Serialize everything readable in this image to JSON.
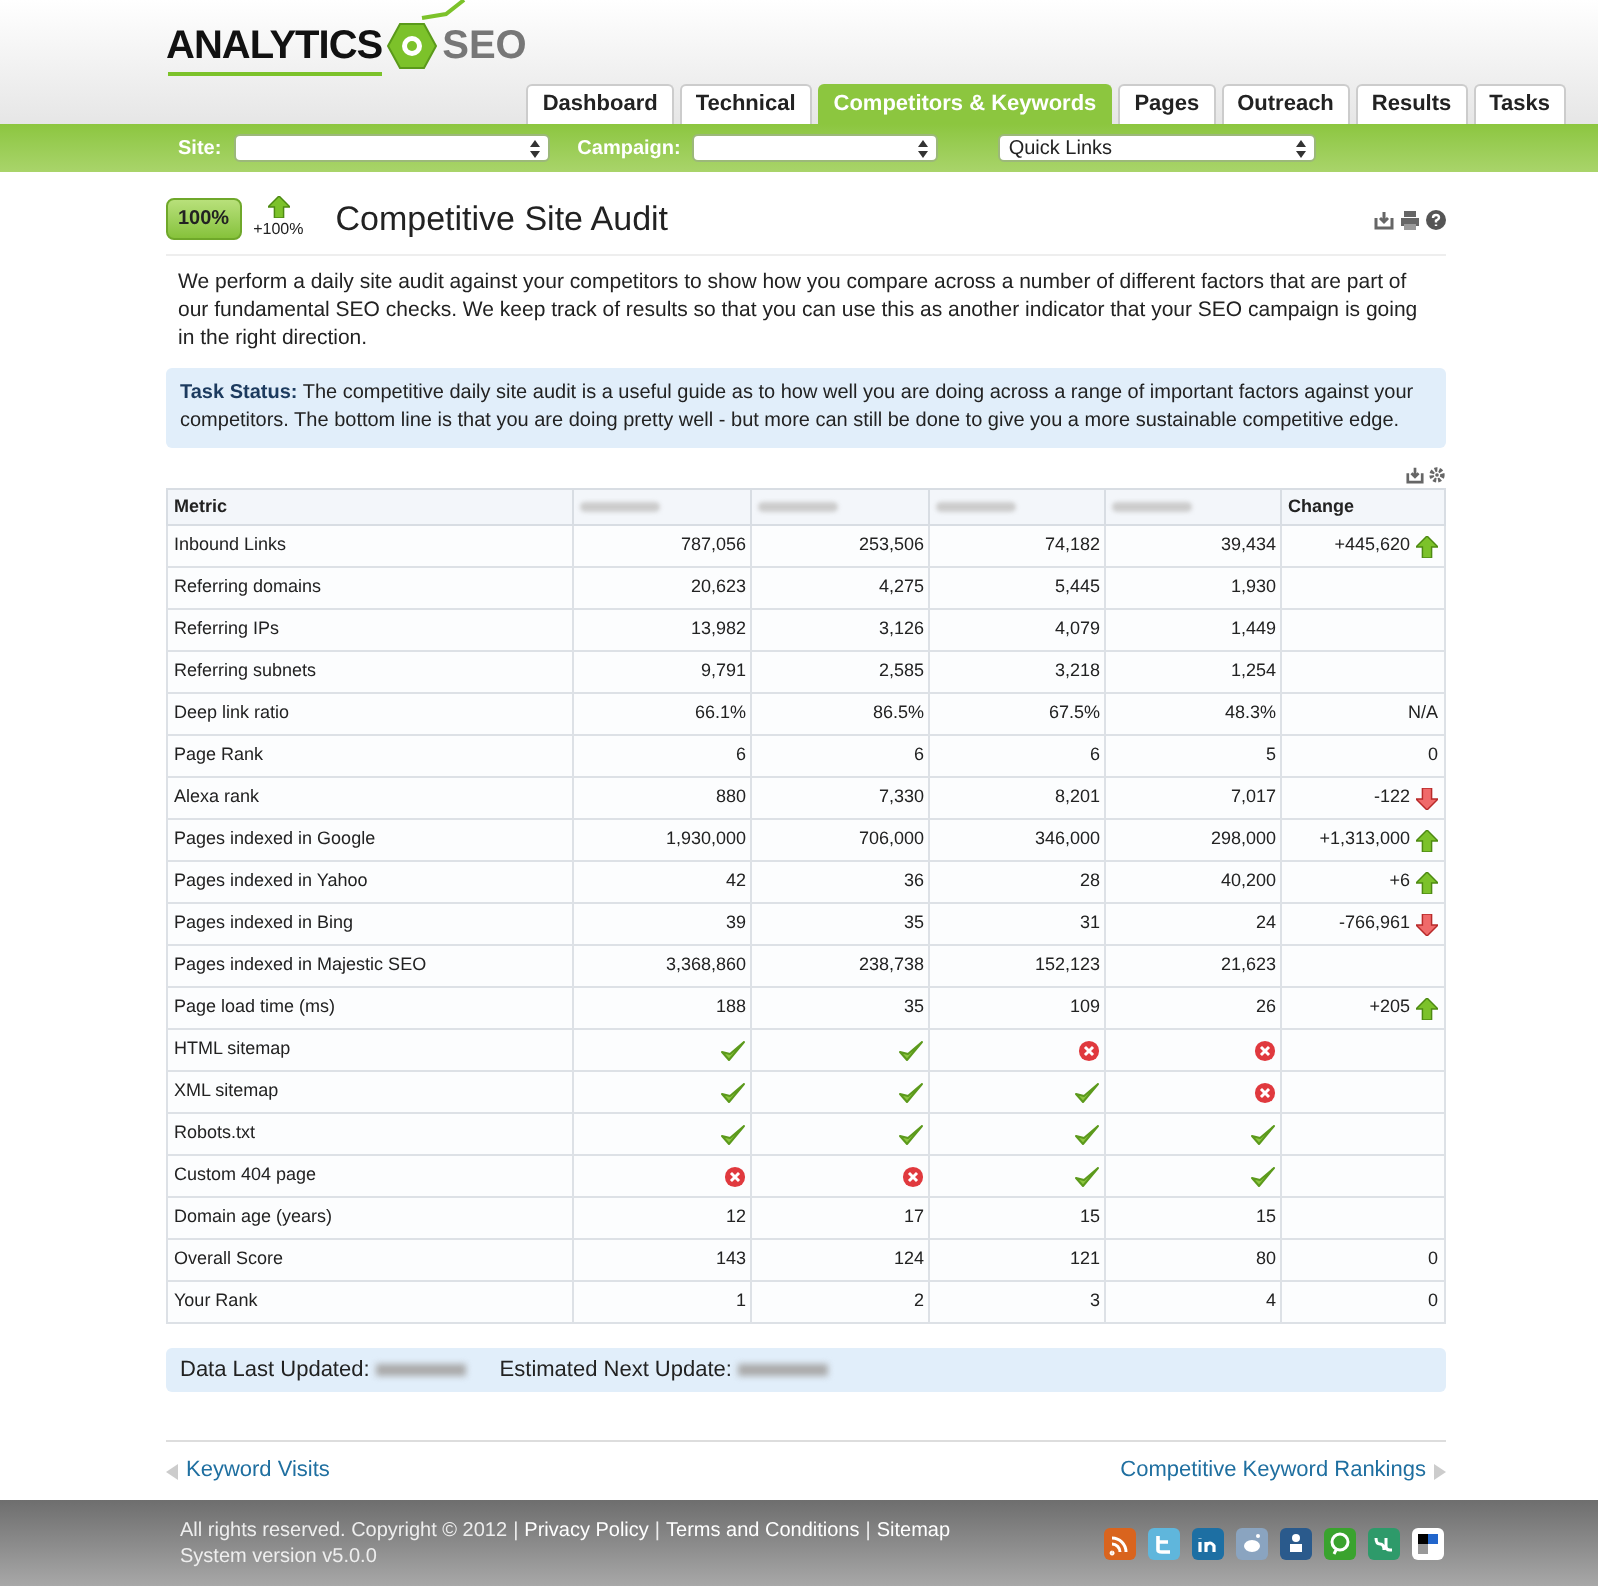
{
  "logo": {
    "word1": "ANALYTICS",
    "word2": "SEO"
  },
  "tabs": [
    {
      "label": "Dashboard",
      "selected": false
    },
    {
      "label": "Technical",
      "selected": false
    },
    {
      "label": "Competitors & Keywords",
      "selected": true
    },
    {
      "label": "Pages",
      "selected": false
    },
    {
      "label": "Outreach",
      "selected": false
    },
    {
      "label": "Results",
      "selected": false
    },
    {
      "label": "Tasks",
      "selected": false
    }
  ],
  "filters": {
    "site_label": "Site:",
    "campaign_label": "Campaign:",
    "quick_links": "Quick Links"
  },
  "score": {
    "badge": "100%",
    "change": "+100%"
  },
  "title": "Competitive Site Audit",
  "intro": "We perform a daily site audit against your competitors to show how you compare across a number of different factors that are part of our fundamental SEO checks. We keep track of results so that you can use this as another indicator that your SEO campaign is going in the right direction.",
  "task_status": "**Task Status:** The competitive daily site audit is a useful guide as to how well you are doing across a range of important factors against your competitors. The bottom line is that you are doing pretty well - but more can still be done to give you a more sustainable competitive edge.",
  "table": {
    "columns": [
      "Metric",
      "Change"
    ],
    "rows": [
      {
        "metric": "Inbound Links",
        "cells": [
          {
            "kind": "value",
            "text": "787,056"
          },
          {
            "kind": "value",
            "text": "253,506"
          },
          {
            "kind": "value",
            "text": "74,182"
          },
          {
            "kind": "value",
            "text": "39,434"
          }
        ],
        "change": {
          "text": "+445,620",
          "increase": true
        }
      },
      {
        "metric": "Referring domains",
        "cells": [
          {
            "kind": "value",
            "text": "20,623"
          },
          {
            "kind": "value",
            "text": "4,275"
          },
          {
            "kind": "value",
            "text": "5,445"
          },
          {
            "kind": "value",
            "text": "1,930"
          }
        ]
      },
      {
        "metric": "Referring IPs",
        "cells": [
          {
            "kind": "value",
            "text": "13,982"
          },
          {
            "kind": "value",
            "text": "3,126"
          },
          {
            "kind": "value",
            "text": "4,079"
          },
          {
            "kind": "value",
            "text": "1,449"
          }
        ]
      },
      {
        "metric": "Referring subnets",
        "cells": [
          {
            "kind": "value",
            "text": "9,791"
          },
          {
            "kind": "value",
            "text": "2,585"
          },
          {
            "kind": "value",
            "text": "3,218"
          },
          {
            "kind": "value",
            "text": "1,254"
          }
        ]
      },
      {
        "metric": "Deep link ratio",
        "cells": [
          {
            "kind": "value",
            "text": "66.1%"
          },
          {
            "kind": "value",
            "text": "86.5%"
          },
          {
            "kind": "value",
            "text": "67.5%"
          },
          {
            "kind": "value",
            "text": "48.3%"
          }
        ],
        "change": {
          "text": "N/A"
        }
      },
      {
        "metric": "Page Rank",
        "cells": [
          {
            "kind": "value",
            "text": "6"
          },
          {
            "kind": "value",
            "text": "6"
          },
          {
            "kind": "value",
            "text": "6"
          },
          {
            "kind": "value",
            "text": "5"
          }
        ],
        "change": {
          "text": "0"
        }
      },
      {
        "metric": "Alexa rank",
        "cells": [
          {
            "kind": "value",
            "text": "880"
          },
          {
            "kind": "value",
            "text": "7,330"
          },
          {
            "kind": "value",
            "text": "8,201"
          },
          {
            "kind": "value",
            "text": "7,017"
          }
        ],
        "change": {
          "text": "-122",
          "increase": false
        }
      },
      {
        "metric": "Pages indexed in Google",
        "cells": [
          {
            "kind": "value",
            "text": "1,930,000"
          },
          {
            "kind": "value",
            "text": "706,000"
          },
          {
            "kind": "value",
            "text": "346,000"
          },
          {
            "kind": "value",
            "text": "298,000"
          }
        ],
        "change": {
          "text": "+1,313,000",
          "increase": true
        }
      },
      {
        "metric": "Pages indexed in Yahoo",
        "cells": [
          {
            "kind": "value",
            "text": "42"
          },
          {
            "kind": "value",
            "text": "36"
          },
          {
            "kind": "value",
            "text": "28"
          },
          {
            "kind": "value",
            "text": "40,200"
          }
        ],
        "change": {
          "text": "+6",
          "increase": true
        }
      },
      {
        "metric": "Pages indexed in Bing",
        "cells": [
          {
            "kind": "value",
            "text": "39"
          },
          {
            "kind": "value",
            "text": "35"
          },
          {
            "kind": "value",
            "text": "31"
          },
          {
            "kind": "value",
            "text": "24"
          }
        ],
        "change": {
          "text": "-766,961",
          "increase": false
        }
      },
      {
        "metric": "Pages indexed in Majestic SEO",
        "cells": [
          {
            "kind": "value",
            "text": "3,368,860"
          },
          {
            "kind": "value",
            "text": "238,738"
          },
          {
            "kind": "value",
            "text": "152,123"
          },
          {
            "kind": "value",
            "text": "21,623"
          }
        ]
      },
      {
        "metric": "Page load time (ms)",
        "cells": [
          {
            "kind": "value",
            "text": "188"
          },
          {
            "kind": "value",
            "text": "35"
          },
          {
            "kind": "value",
            "text": "109"
          },
          {
            "kind": "value",
            "text": "26"
          }
        ],
        "change": {
          "text": "+205",
          "increase": true
        }
      },
      {
        "metric": "HTML sitemap",
        "cells": [
          {
            "kind": "pass"
          },
          {
            "kind": "pass"
          },
          {
            "kind": "fail"
          },
          {
            "kind": "fail"
          }
        ]
      },
      {
        "metric": "XML sitemap",
        "cells": [
          {
            "kind": "pass"
          },
          {
            "kind": "pass"
          },
          {
            "kind": "pass"
          },
          {
            "kind": "fail"
          }
        ]
      },
      {
        "metric": "Robots.txt",
        "cells": [
          {
            "kind": "pass"
          },
          {
            "kind": "pass"
          },
          {
            "kind": "pass"
          },
          {
            "kind": "pass"
          }
        ]
      },
      {
        "metric": "Custom 404 page",
        "cells": [
          {
            "kind": "fail"
          },
          {
            "kind": "fail"
          },
          {
            "kind": "pass"
          },
          {
            "kind": "pass"
          }
        ]
      },
      {
        "metric": "Domain age (years)",
        "cells": [
          {
            "kind": "value",
            "text": "12"
          },
          {
            "kind": "value",
            "text": "17"
          },
          {
            "kind": "value",
            "text": "15"
          },
          {
            "kind": "value",
            "text": "15"
          }
        ]
      },
      {
        "metric": "Overall Score",
        "cells": [
          {
            "kind": "value",
            "text": "143"
          },
          {
            "kind": "value",
            "text": "124"
          },
          {
            "kind": "value",
            "text": "121"
          },
          {
            "kind": "value",
            "text": "80"
          }
        ],
        "change": {
          "text": "0"
        }
      },
      {
        "metric": "Your Rank",
        "cells": [
          {
            "kind": "value",
            "text": "1"
          },
          {
            "kind": "value",
            "text": "2"
          },
          {
            "kind": "value",
            "text": "3"
          },
          {
            "kind": "value",
            "text": "4"
          }
        ],
        "change": {
          "text": "0"
        }
      }
    ]
  },
  "updates": {
    "last": "Data Last Updated:",
    "next": "Estimated Next Update:"
  },
  "nav": {
    "prev": "Keyword Visits",
    "next": "Competitive Keyword Rankings"
  },
  "footer": {
    "copyright": "All rights reserved. Copyright © 2012",
    "separator": "|",
    "links": [
      "Privacy Policy",
      "Terms and Conditions",
      "Sitemap"
    ],
    "version": "System version v5.0.0"
  }
}
